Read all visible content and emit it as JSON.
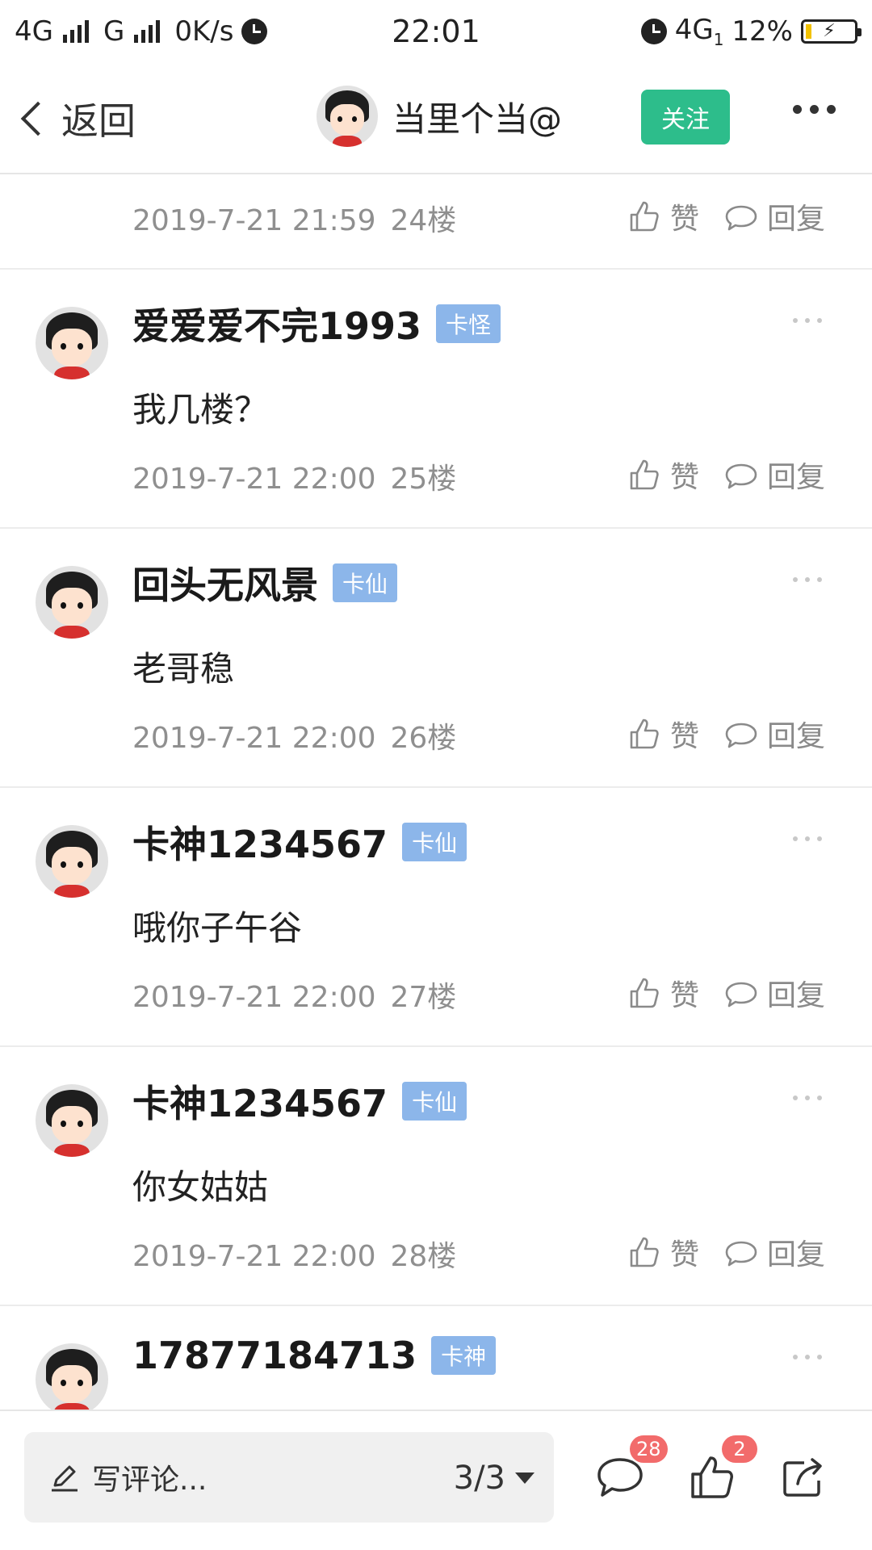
{
  "status_bar": {
    "net1": "4G",
    "net2": "G",
    "speed": "0K/s",
    "time": "22:01",
    "net3": "4G",
    "net3_sub": "1",
    "battery": "12%"
  },
  "header": {
    "back_label": "返回",
    "user_name": "当里个当@",
    "follow_label": "关注"
  },
  "actions": {
    "like_label": "赞",
    "reply_label": "回复"
  },
  "partial_comment": {
    "date": "2019-7-21 21:59",
    "floor": "24楼"
  },
  "comments": [
    {
      "name": "爱爱爱不完1993",
      "badge": "卡怪",
      "text": "我几楼？",
      "date": "2019-7-21 22:00",
      "floor": "25楼"
    },
    {
      "name": "回头无风景",
      "badge": "卡仙",
      "text": "老哥稳",
      "date": "2019-7-21 22:00",
      "floor": "26楼"
    },
    {
      "name": "卡神1234567",
      "badge": "卡仙",
      "text": "哦你子午谷",
      "date": "2019-7-21 22:00",
      "floor": "27楼"
    },
    {
      "name": "卡神1234567",
      "badge": "卡仙",
      "text": "你女姑姑",
      "date": "2019-7-21 22:00",
      "floor": "28楼"
    },
    {
      "name": "17877184713",
      "badge": "卡神",
      "text": "",
      "date": "",
      "floor": ""
    }
  ],
  "bottom_bar": {
    "placeholder": "写评论...",
    "page": "3/3",
    "comment_count": "28",
    "like_count": "2"
  },
  "colors": {
    "follow_button": "#2dbd8b",
    "badge": "#8cb6ea",
    "count_badge": "#f26b6b"
  }
}
